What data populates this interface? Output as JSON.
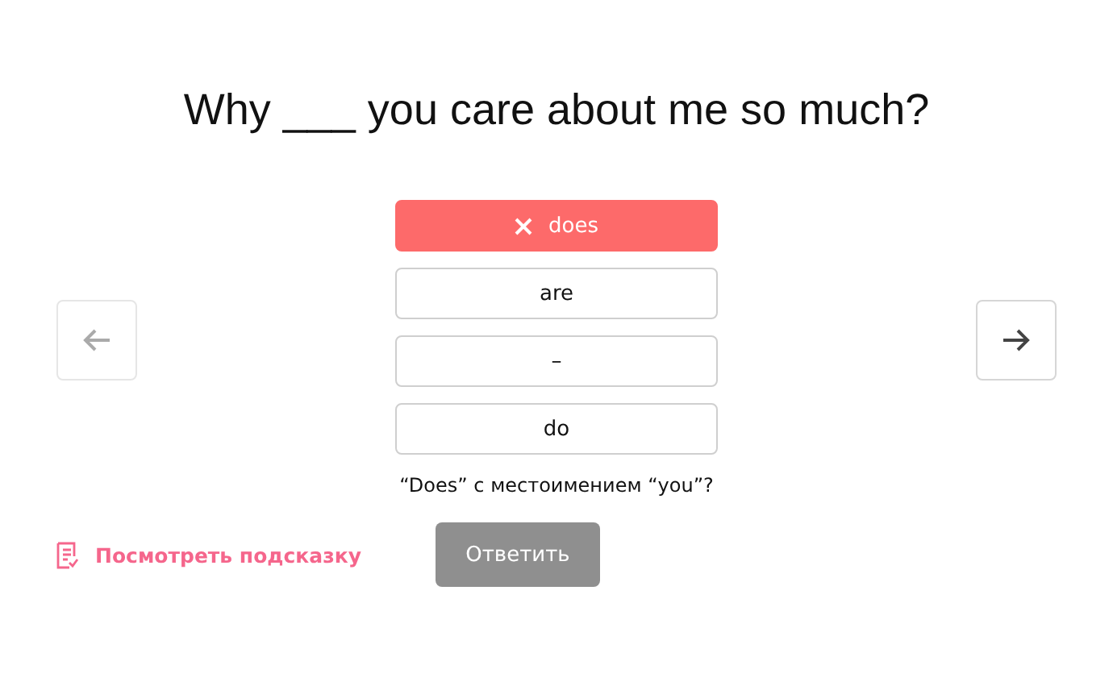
{
  "question": "Why ___ you care about me so much?",
  "nav": {
    "prev_disabled": true,
    "next_disabled": false
  },
  "options": [
    {
      "label": "does",
      "selected": true
    },
    {
      "label": "are",
      "selected": false
    },
    {
      "label": "–",
      "selected": false
    },
    {
      "label": "do",
      "selected": false
    }
  ],
  "result": {
    "kind": "wrong"
  },
  "feedback": "“Does” с местоимением “you”?",
  "hint_link": "Посмотреть подсказку",
  "answer_button": {
    "label": "Ответить",
    "disabled": true
  }
}
